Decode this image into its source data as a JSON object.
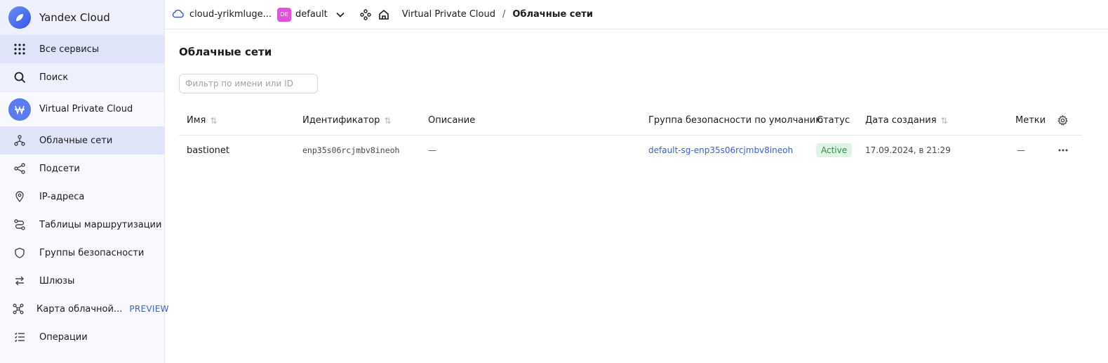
{
  "brand": {
    "title": "Yandex Cloud"
  },
  "sidebar": {
    "top_items": [
      {
        "label": "Все сервисы",
        "icon": "grid-icon"
      },
      {
        "label": "Поиск",
        "icon": "search-icon"
      }
    ],
    "service": {
      "title": "Virtual Private Cloud",
      "icon": "vpc-icon"
    },
    "items": [
      {
        "label": "Облачные сети",
        "icon": "network-icon",
        "active": true
      },
      {
        "label": "Подсети",
        "icon": "subnet-icon"
      },
      {
        "label": "IP-адреса",
        "icon": "location-pin-icon"
      },
      {
        "label": "Таблицы маршрутизации",
        "icon": "route-icon"
      },
      {
        "label": "Группы безопасности",
        "icon": "shield-icon"
      },
      {
        "label": "Шлюзы",
        "icon": "arrows-exchange-icon"
      },
      {
        "label": "Карта облачной...",
        "icon": "map-nodes-icon",
        "tag": "PREVIEW"
      },
      {
        "label": "Операции",
        "icon": "list-icon"
      }
    ]
  },
  "topbar": {
    "cloud_name": "cloud-yrikmluge...",
    "folder_badge": "DE",
    "folder_name": "default",
    "breadcrumb_service": "Virtual Private Cloud",
    "breadcrumb_separator": "/",
    "breadcrumb_current": "Облачные сети"
  },
  "main": {
    "page_title": "Облачные сети",
    "filter_placeholder": "Фильтр по имени или ID",
    "columns": {
      "name": "Имя",
      "id": "Идентификатор",
      "description": "Описание",
      "security_group": "Группа безопасности по умолчанию",
      "status": "Статус",
      "created": "Дата создания",
      "labels": "Метки"
    },
    "rows": [
      {
        "name": "bastionet",
        "id": "enp35s06rcjmbv8ineoh",
        "description": "—",
        "security_group": "default-sg-enp35s06rcjmbv8ineoh",
        "status": "Active",
        "created": "17.09.2024, в 21:29",
        "labels": "—"
      }
    ]
  },
  "colors": {
    "accent": "#3b5fcf",
    "status_active_bg": "#dff4e4",
    "status_active_fg": "#2f8a45",
    "folder_badge": "#e84ee0"
  }
}
